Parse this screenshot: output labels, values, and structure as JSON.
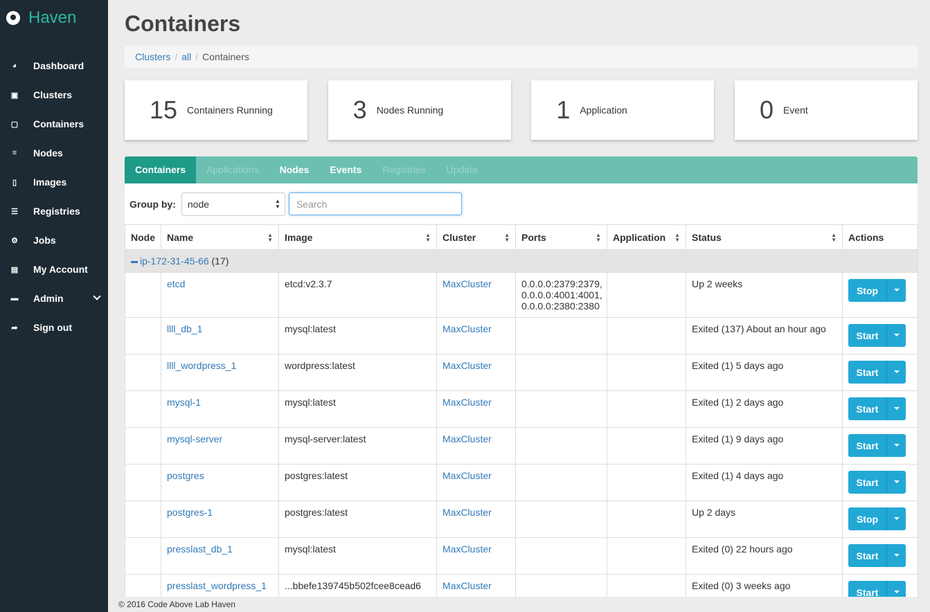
{
  "brand": {
    "name": "Haven"
  },
  "sidebar": {
    "items": [
      {
        "label": "Dashboard",
        "icon": "dashboard-icon",
        "glyph": "◕"
      },
      {
        "label": "Clusters",
        "icon": "clusters-icon",
        "glyph": "▣"
      },
      {
        "label": "Containers",
        "icon": "containers-icon",
        "glyph": "▢"
      },
      {
        "label": "Nodes",
        "icon": "nodes-icon",
        "glyph": "≡"
      },
      {
        "label": "Images",
        "icon": "images-icon",
        "glyph": "▯"
      },
      {
        "label": "Registries",
        "icon": "registries-icon",
        "glyph": "☰"
      },
      {
        "label": "Jobs",
        "icon": "jobs-icon",
        "glyph": "⚙"
      },
      {
        "label": "My Account",
        "icon": "account-icon",
        "glyph": "▤"
      },
      {
        "label": "Admin",
        "icon": "admin-icon",
        "glyph": "▬"
      },
      {
        "label": "Sign out",
        "icon": "sign-out-icon",
        "glyph": "➦"
      }
    ]
  },
  "page": {
    "title": "Containers"
  },
  "breadcrumb": {
    "item1": "Clusters",
    "item2": "all",
    "current": "Containers"
  },
  "stats": [
    {
      "value": "15",
      "label": "Containers Running"
    },
    {
      "value": "3",
      "label": "Nodes Running"
    },
    {
      "value": "1",
      "label": "Application"
    },
    {
      "value": "0",
      "label": "Event"
    }
  ],
  "tabs": [
    {
      "label": "Containers",
      "state": "active"
    },
    {
      "label": "Applications",
      "state": "off"
    },
    {
      "label": "Nodes",
      "state": "on"
    },
    {
      "label": "Events",
      "state": "on"
    },
    {
      "label": "Registries",
      "state": "off"
    },
    {
      "label": "Update",
      "state": "off"
    }
  ],
  "toolbar": {
    "group_label": "Group by:",
    "group_value": "node",
    "search_placeholder": "Search"
  },
  "table": {
    "columns": [
      "Node",
      "Name",
      "Image",
      "Cluster",
      "Ports",
      "Application",
      "Status",
      "Actions"
    ],
    "group": {
      "name": "ip-172-31-45-66",
      "count": "(17)"
    },
    "rows": [
      {
        "name": "etcd",
        "image": "etcd:v2.3.7",
        "cluster": "MaxCluster",
        "ports": [
          "0.0.0.0:2379:2379,",
          "0.0.0.0:4001:4001,",
          "0.0.0.0:2380:2380"
        ],
        "application": "",
        "status": "Up 2 weeks",
        "action": "Stop"
      },
      {
        "name": "llll_db_1",
        "image": "mysql:latest",
        "cluster": "MaxCluster",
        "ports": [],
        "application": "",
        "status": "Exited (137) About an hour ago",
        "action": "Start"
      },
      {
        "name": "llll_wordpress_1",
        "image": "wordpress:latest",
        "cluster": "MaxCluster",
        "ports": [],
        "application": "",
        "status": "Exited (1) 5 days ago",
        "action": "Start"
      },
      {
        "name": "mysql-1",
        "image": "mysql:latest",
        "cluster": "MaxCluster",
        "ports": [],
        "application": "",
        "status": "Exited (1) 2 days ago",
        "action": "Start"
      },
      {
        "name": "mysql-server",
        "image": "mysql-server:latest",
        "cluster": "MaxCluster",
        "ports": [],
        "application": "",
        "status": "Exited (1) 9 days ago",
        "action": "Start"
      },
      {
        "name": "postgres",
        "image": "postgres:latest",
        "cluster": "MaxCluster",
        "ports": [],
        "application": "",
        "status": "Exited (1) 4 days ago",
        "action": "Start"
      },
      {
        "name": "postgres-1",
        "image": "postgres:latest",
        "cluster": "MaxCluster",
        "ports": [],
        "application": "",
        "status": "Up 2 days",
        "action": "Stop"
      },
      {
        "name": "presslast_db_1",
        "image": "mysql:latest",
        "cluster": "MaxCluster",
        "ports": [],
        "application": "",
        "status": "Exited (0) 22 hours ago",
        "action": "Start"
      },
      {
        "name": "presslast_wordpress_1",
        "image": "...bbefe139745b502fcee8cead6",
        "cluster": "MaxCluster",
        "ports": [],
        "application": "",
        "status": "Exited (0) 3 weeks ago",
        "action": "Start"
      }
    ]
  },
  "footer": {
    "text": "© 2016 Code Above Lab Haven"
  }
}
